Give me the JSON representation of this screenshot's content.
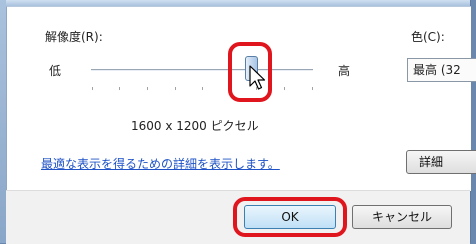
{
  "dialog": {
    "resolution_label": "解像度(R):",
    "low_label": "低",
    "high_label": "高",
    "resolution_value": "1600 x 1200 ピクセル",
    "color_label": "色(C):",
    "color_value": "最高 (32",
    "help_link": "最適な表示を得るための詳細を表示します。",
    "advanced_button": "詳細",
    "ok_button": "OK",
    "cancel_button": "キャンセル"
  },
  "slider": {
    "level": 0.72
  },
  "annotation": {
    "color": "#e0161e"
  }
}
